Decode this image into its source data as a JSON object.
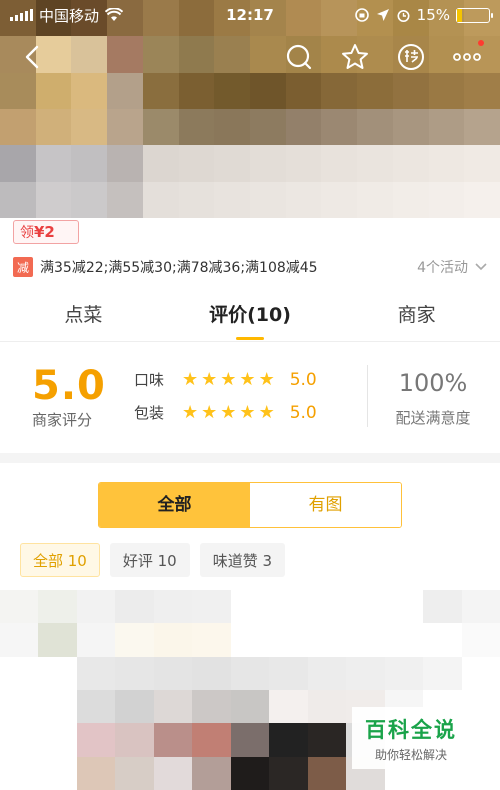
{
  "status": {
    "carrier": "中国移动",
    "time": "12:17",
    "battery": "15%",
    "battery_level": 0.15
  },
  "coupon": {
    "prefix": "领",
    "amount": "¥2"
  },
  "promo": {
    "tag": "减",
    "text": "满35减22;满55减30;满78减36;满108减45",
    "count": "4个活动"
  },
  "tabs": [
    {
      "label": "点菜"
    },
    {
      "label": "评价(10)"
    },
    {
      "label": "商家"
    }
  ],
  "rating": {
    "score": "5.0",
    "score_label": "商家评分",
    "taste": {
      "label": "口味",
      "stars": 5,
      "value": "5.0"
    },
    "packaging": {
      "label": "包装",
      "stars": 5,
      "value": "5.0"
    },
    "delivery_pct": "100%",
    "delivery_label": "配送满意度"
  },
  "segment": {
    "all": "全部",
    "with_pics": "有图"
  },
  "chips": [
    {
      "label": "全部 10"
    },
    {
      "label": "好评 10"
    },
    {
      "label": "味道赞 3"
    }
  ],
  "watermark": {
    "title": "百科全说",
    "subtitle": "助你轻松解决"
  },
  "colors": {
    "accent": "#ffc33b",
    "star": "#ffc21a",
    "score": "#f5a000",
    "promo_tag": "#f26a52"
  }
}
